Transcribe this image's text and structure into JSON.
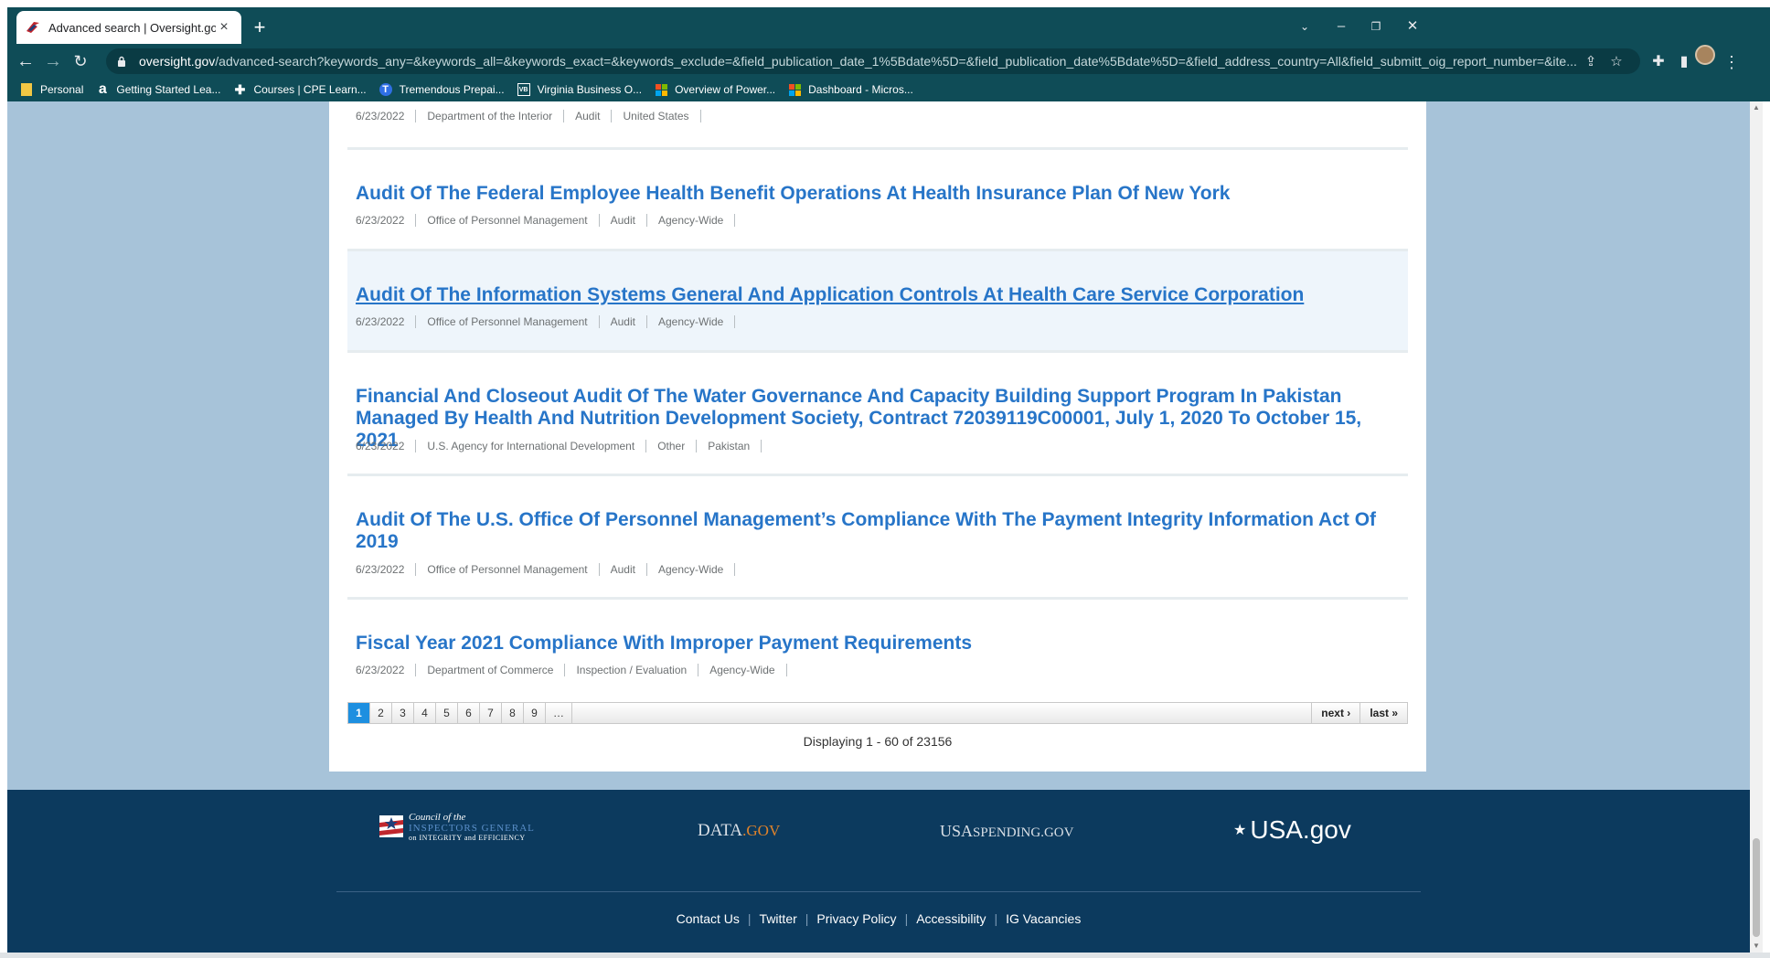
{
  "browser": {
    "tab_title": "Advanced search | Oversight.gov",
    "url_host": "oversight.gov",
    "url_path": "/advanced-search?keywords_any=&keywords_all=&keywords_exact=&keywords_exclude=&field_publication_date_1%5Bdate%5D=&field_publication_date%5Bdate%5D=&field_address_country=All&field_submitt_oig_report_number=&ite...",
    "new_tab": "+",
    "close": "×",
    "bookmarks": [
      {
        "label": "Personal",
        "icon": "folder-icon"
      },
      {
        "label": "Getting Started Lea...",
        "icon": "a-icon"
      },
      {
        "label": "Courses | CPE Learn...",
        "icon": "plus-icon"
      },
      {
        "label": "Tremendous Prepai...",
        "icon": "t-icon"
      },
      {
        "label": "Virginia Business O...",
        "icon": "vbo-icon"
      },
      {
        "label": "Overview of Power...",
        "icon": "microsoft-icon"
      },
      {
        "label": "Dashboard - Micros...",
        "icon": "microsoft-icon"
      }
    ]
  },
  "results": [
    {
      "title": "",
      "date": "6/23/2022",
      "agency": "Department of the Interior",
      "type": "Audit",
      "location": "United States"
    },
    {
      "title": "Audit Of The Federal Employee Health Benefit Operations At Health Insurance Plan Of New York",
      "date": "6/23/2022",
      "agency": "Office of Personnel Management",
      "type": "Audit",
      "location": "Agency-Wide"
    },
    {
      "title": "Audit Of The Information Systems General And Application Controls At Health Care Service Corporation",
      "date": "6/23/2022",
      "agency": "Office of Personnel Management",
      "type": "Audit",
      "location": "Agency-Wide"
    },
    {
      "title_line1": "Financial And Closeout Audit Of The Water Governance And Capacity Building Support Program In Pakistan",
      "title_line2": "Managed By Health And Nutrition Development Society, Contract 72039119C00001, July 1, 2020 To October 15, 2021",
      "date": "6/23/2022",
      "agency": "U.S. Agency for International Development",
      "type": "Other",
      "location": "Pakistan"
    },
    {
      "title_line1": "Audit Of The U.S. Office Of Personnel Management’s Compliance With The Payment Integrity Information Act Of",
      "title_line2": "2019",
      "date": "6/23/2022",
      "agency": "Office of Personnel Management",
      "type": "Audit",
      "location": "Agency-Wide"
    },
    {
      "title": "Fiscal Year 2021 Compliance With Improper Payment Requirements",
      "date": "6/23/2022",
      "agency": "Department of Commerce",
      "type": "Inspection / Evaluation",
      "location": "Agency-Wide"
    }
  ],
  "pager": {
    "pages": [
      "1",
      "2",
      "3",
      "4",
      "5",
      "6",
      "7",
      "8",
      "9",
      "…"
    ],
    "next": "next ›",
    "last": "last »",
    "displaying": "Displaying 1 - 60 of 23156"
  },
  "footer": {
    "cigie_line1": "Council of the",
    "cigie_line2": "INSPECTORS GENERAL",
    "cigie_line3": "on INTEGRITY and EFFICIENCY",
    "data_gov_a": "DATA",
    "data_gov_b": ".GOV",
    "usaspending_a": "USA",
    "usaspending_b": "SPENDING.GOV",
    "usa_gov": "USA.gov",
    "links": [
      "Contact Us",
      "Twitter",
      "Privacy Policy",
      "Accessibility",
      "IG Vacancies"
    ]
  },
  "colors": {
    "chrome": "#0f4c57",
    "link": "#2775c8",
    "page_bg": "#a7c3d9",
    "footer": "#0c3a5e",
    "pager_active": "#1d8fe0"
  }
}
